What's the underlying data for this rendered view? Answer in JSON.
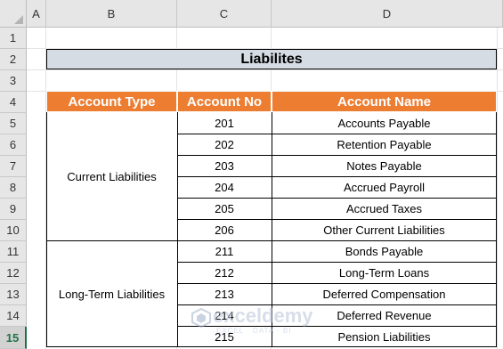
{
  "columns": [
    "A",
    "B",
    "C",
    "D"
  ],
  "rows": [
    "1",
    "2",
    "3",
    "4",
    "5",
    "6",
    "7",
    "8",
    "9",
    "10",
    "11",
    "12",
    "13",
    "14",
    "15"
  ],
  "title": "Liabilites",
  "table": {
    "headers": [
      "Account Type",
      "Account No",
      "Account Name"
    ],
    "groups": [
      {
        "type": "Current Liabilities",
        "rows": [
          {
            "no": "201",
            "name": "Accounts Payable"
          },
          {
            "no": "202",
            "name": "Retention Payable"
          },
          {
            "no": "203",
            "name": "Notes Payable"
          },
          {
            "no": "204",
            "name": "Accrued Payroll"
          },
          {
            "no": "205",
            "name": "Accrued Taxes"
          },
          {
            "no": "206",
            "name": "Other Current Liabilities"
          }
        ]
      },
      {
        "type": "Long-Term Liabilities",
        "rows": [
          {
            "no": "211",
            "name": "Bonds Payable"
          },
          {
            "no": "212",
            "name": "Long-Term Loans"
          },
          {
            "no": "213",
            "name": "Deferred Compensation"
          },
          {
            "no": "214",
            "name": "Deferred Revenue"
          },
          {
            "no": "215",
            "name": "Pension Liabilities"
          }
        ]
      }
    ]
  },
  "watermark": {
    "name": "exceldemy",
    "tagline": "EXCEL · DATA · BI"
  },
  "colors": {
    "header_bg": "#ed7d31",
    "title_bg": "#d6dce4",
    "active_row": "#1e7145"
  }
}
